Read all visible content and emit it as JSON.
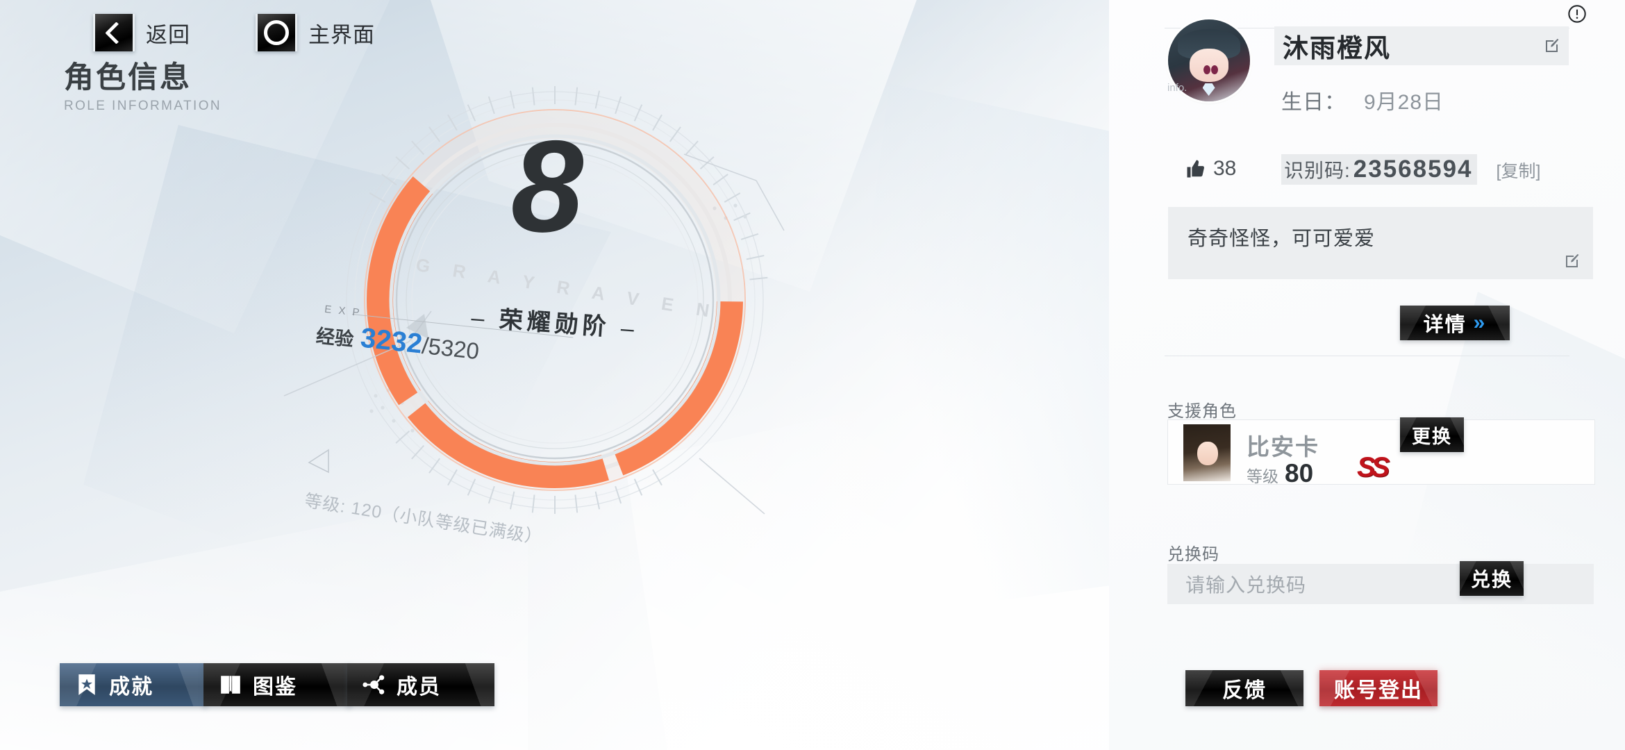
{
  "nav": {
    "back_label": "返回",
    "back_icon": "chevron-left-icon",
    "home_label": "主界面",
    "home_icon": "circle-icon"
  },
  "page_title": {
    "cn": "角色信息",
    "en": "ROLE INFORMATION"
  },
  "rank_panel": {
    "watermark": "G R A Y   R A V E N",
    "rank_number": "8",
    "rank_label_left_dash": "–",
    "rank_label": "荣耀勋阶",
    "rank_label_right_dash": "–",
    "exp_tag": "E X P",
    "exp_cn": "经验",
    "exp_current": "3232",
    "exp_max": "/5320",
    "level_text": "等级: 120（小队等级已满级）",
    "ring_color": "#f98355",
    "ring_track_color": "#dfe3e7",
    "exp_value_color": "#2a7fd4",
    "progress_percent": 61
  },
  "action_buttons": [
    {
      "label": "成就",
      "icon": "bookmark-star-icon",
      "style": "blue"
    },
    {
      "label": "图鉴",
      "icon": "book-icon",
      "style": "dark"
    },
    {
      "label": "成员",
      "icon": "network-nodes-icon",
      "style": "dark"
    }
  ],
  "profile": {
    "info_icon": "exclamation-circle-icon",
    "avatar_icon": "player-avatar",
    "avatar_watermark": "info.",
    "name": "沐雨橙风",
    "name_edit_icon": "edit-pencil-icon",
    "birthday_label": "生日：",
    "birthday_value": "9月28日",
    "likes_icon": "thumbs-up-icon",
    "likes_count": "38",
    "uid_label": "识别码:",
    "uid_value": "23568594",
    "copy_label": "[复制]",
    "signature": "奇奇怪怪，可可爱爱",
    "signature_edit_icon": "edit-pencil-icon",
    "detail_label": "详情",
    "detail_icon": "double-chevron-right-icon"
  },
  "support": {
    "section_title": "支援角色",
    "character_name": "比安卡",
    "level_label": "等级",
    "level_value": "80",
    "rank_badge": "SS",
    "rank_badge_color": "#c0131b",
    "change_button": "更换"
  },
  "redeem": {
    "section_title": "兑换码",
    "placeholder": "请输入兑换码",
    "value": "",
    "button_label": "兑换"
  },
  "footer": {
    "feedback_label": "反馈",
    "logout_label": "账号登出",
    "logout_color": "#bd2a2f"
  }
}
